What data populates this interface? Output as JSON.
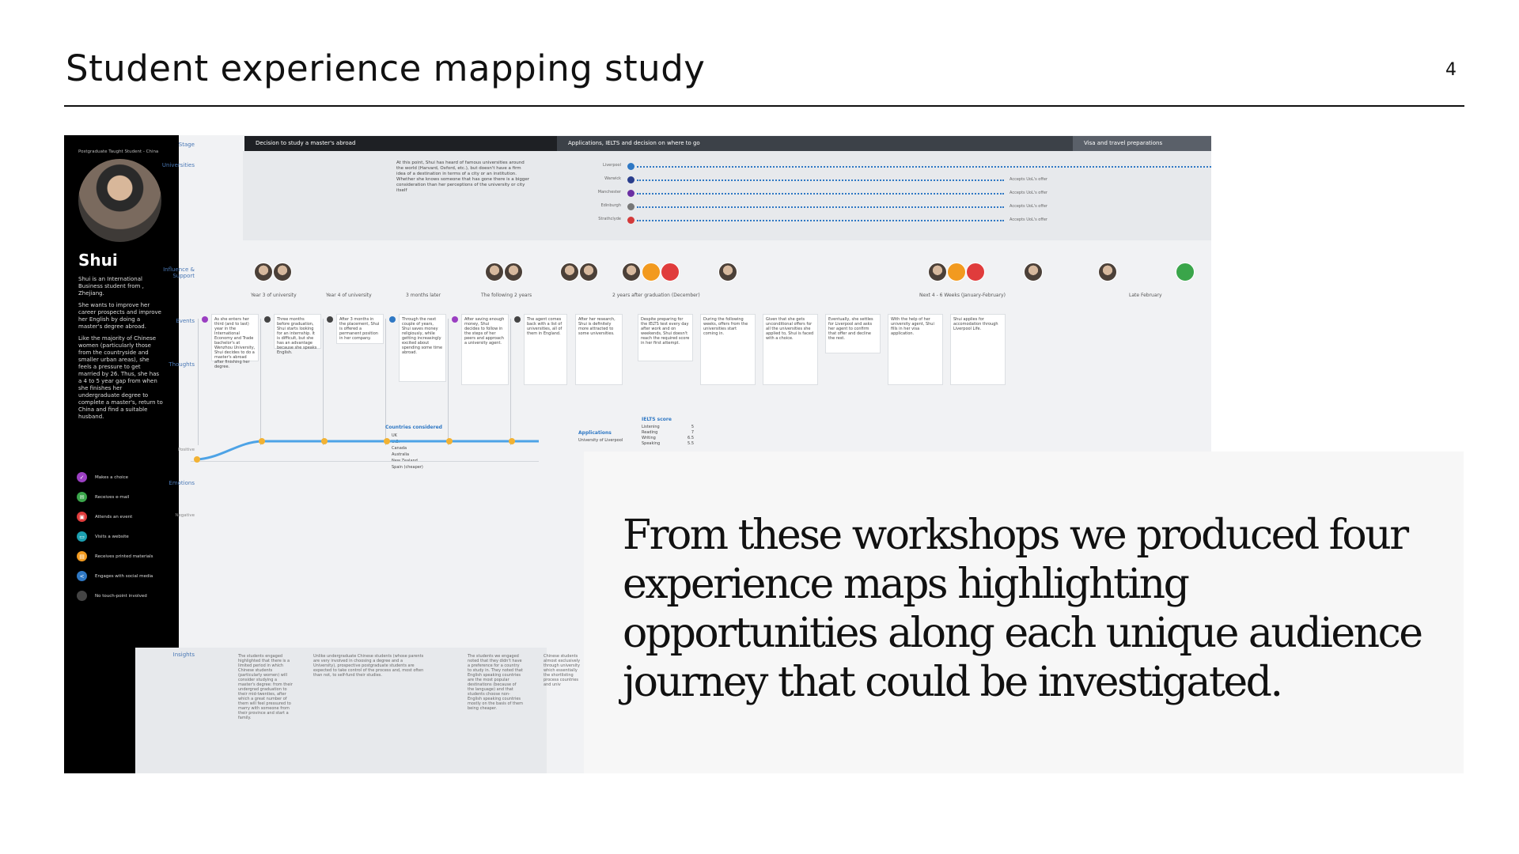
{
  "slide": {
    "title": "Student experience mapping study",
    "page_number": "4",
    "quote": "From these workshops we produced four experience maps highlighting opportunities along each unique audience journey that could be investigated."
  },
  "map": {
    "persona": {
      "tag": "Postgraduate Taught Student - China",
      "name": "Shui",
      "bio": [
        "Shui is an International Business student from , Zhejiang.",
        "She wants to improve her career prospects and improve her English by doing a master's degree abroad.",
        "Like the majority of Chinese women (particularly those from the countryside and smaller urban areas), she feels a pressure to get married by 26. Thus, she has a 4 to 5 year gap from when she finishes her undergraduate degree to complete a master's, return to China and find a suitable husband."
      ],
      "legend": [
        {
          "label": "Makes a choice",
          "color": "#9b3fc2",
          "icon": "choice-icon"
        },
        {
          "label": "Receives e-mail",
          "color": "#3aa54a",
          "icon": "email-icon"
        },
        {
          "label": "Attends an event",
          "color": "#e03c3c",
          "icon": "event-icon"
        },
        {
          "label": "Visits a website",
          "color": "#1b9fb0",
          "icon": "website-icon"
        },
        {
          "label": "Receives printed materials",
          "color": "#f29a1f",
          "icon": "print-icon"
        },
        {
          "label": "Engages with social media",
          "color": "#2f78c4",
          "icon": "social-icon"
        },
        {
          "label": "No touch-point involved",
          "color": "#444444",
          "icon": "none-icon"
        }
      ]
    },
    "row_labels": {
      "stage": "Stage",
      "universities": "Universities",
      "influence": "Influence & Support",
      "events": "Events",
      "thoughts": "Thoughts",
      "positive": "Positive",
      "emotions": "Emotions",
      "negative": "Negative",
      "insights": "Insights"
    },
    "stages": [
      {
        "label": "Decision to study a master's abroad",
        "color": "#1e2024"
      },
      {
        "label": "Applications, IELTS and decision on where to go",
        "color": "#3c4148"
      },
      {
        "label": "Visa and travel preparations",
        "color": "#5a6069"
      }
    ],
    "universities_note": "At this point, Shui has heard of famous universities around the world (Harvard, Oxford, etc.), but doesn't have a firm idea of a destination in terms of a city or an institution. Whether she knows someone that has gone there is a bigger consideration than her perceptions of the university or city itself",
    "universities": [
      {
        "name": "Liverpool",
        "note": "",
        "color": "#2f78c4"
      },
      {
        "name": "Warwick",
        "note": "Accepts UoL's offer",
        "color": "#2a3e8c"
      },
      {
        "name": "Manchester",
        "note": "Accepts UoL's offer",
        "color": "#6b2fa3"
      },
      {
        "name": "Edinburgh",
        "note": "Accepts UoL's offer",
        "color": "#777777"
      },
      {
        "name": "Strathclyde",
        "note": "Accepts UoL's offer",
        "color": "#d33a3a"
      }
    ],
    "periods": [
      "Year 3 of university",
      "Year 4 of university",
      "3 months later",
      "The following 2 years",
      "2 years after graduation (December)",
      "Next 4 - 6 Weeks (January-February)",
      "Late February"
    ],
    "events": [
      "As she enters her third (and to last) year in the International Economy and Trade bachelor's at Wenzhou University, Shui decides to do a master's abroad after finishing her degree.",
      "Three months before graduation, Shui starts looking for an internship. It is difficult, but she has an advantage because she speaks English.",
      "After 3 months in the placement, Shui is offered a permanent position in her company.",
      "Through the next couple of years, Shui saves money religiously, while getting increasingly excited about spending some time abroad.",
      "After saving enough money, Shui decides to follow in the steps of her peers and approach a university agent.",
      "The agent comes back with a list of universities, all of them in England.",
      "After her research, Shui is definitely more attracted to some universities.",
      "Despite preparing for the IELTS test every day after work and on weekends, Shui doesn't reach the required score in her first attempt.",
      "During the following weeks, offers from the universities start coming in.",
      "Given that she gets unconditional offers for all the universities she applied to, Shui is faced with a choice.",
      "Eventually, she settles for Liverpool and asks her agent to confirm that offer and decline the rest.",
      "With the help of her university agent, Shui fills in her visa application.",
      "Shui applies for accomodation through Liverpool Life."
    ],
    "extra_labels": {
      "countries_title": "Countries considered",
      "countries": [
        "UK",
        "U.S.",
        "Canada",
        "Australia",
        "New Zealand",
        "Spain (cheaper)"
      ],
      "ielts_title": "IELTS score",
      "ielts": [
        [
          "Listening",
          "5"
        ],
        [
          "Reading",
          "7"
        ],
        [
          "Writing",
          "6.5"
        ],
        [
          "Speaking",
          "5.5"
        ]
      ],
      "applications_title": "Applications",
      "applications_item": "University of Liverpool"
    },
    "insights": [
      "The students engaged highlighted that there is a limited period in which Chinese students (particularly women) will consider studying a master's degree: from their undergrad graduation to their mid-twenties, after which a great number of them will feel pressured to marry with someone from their province and start a family.",
      "Unlike undergraduate Chinese students (whose parents are very involved in choosing a degree and a University), prospective postgraduate students are expected to take control of the process and, most often than not, to self-fund their studies.",
      "The students we engaged noted that they didn't have a preference for a country to study in. They noted that English speaking countries are the most popular destinations (because of the language) and that students choose non-English speaking countries mostly on the basis of them being cheaper.",
      "Chinese students almost exclusively through university which essentially the shortlisting process countries and univ"
    ]
  }
}
